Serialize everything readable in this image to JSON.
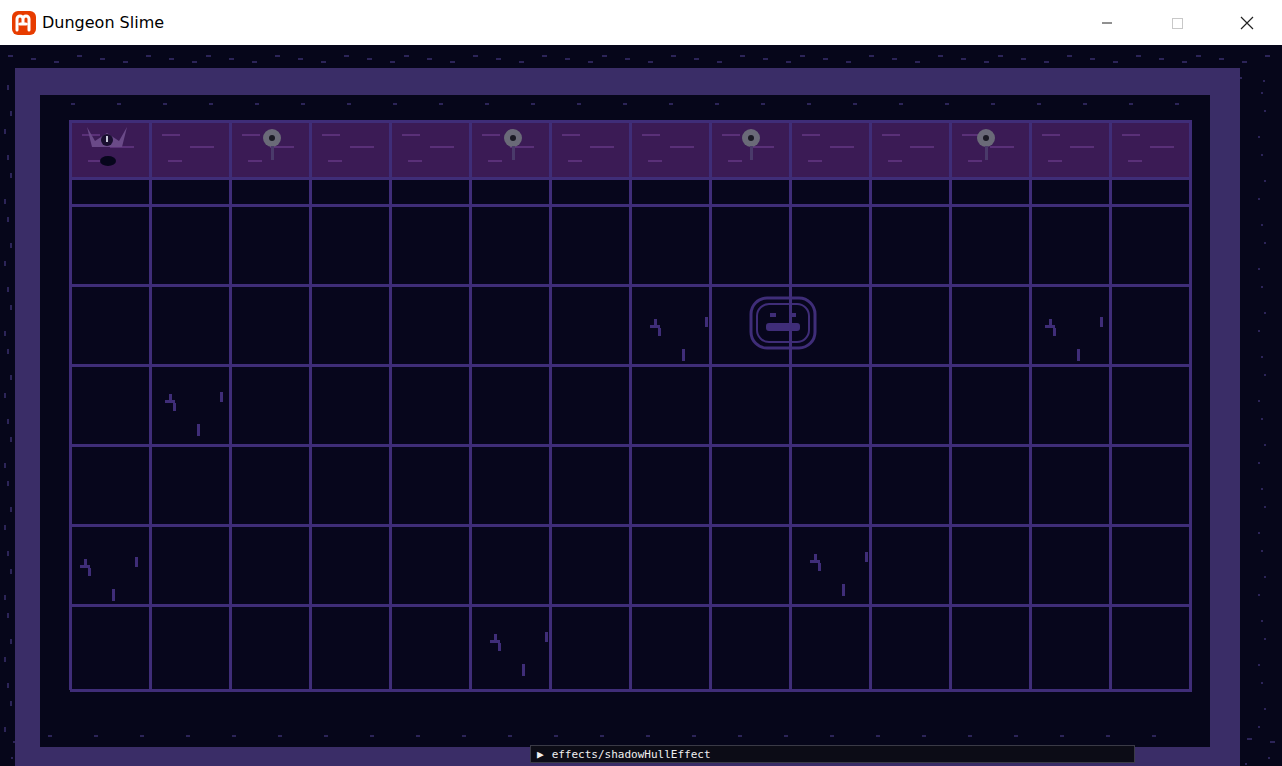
{
  "window": {
    "title": "Dungeon Slime",
    "controls": [
      {
        "kind": "minimize",
        "disabled": false
      },
      {
        "kind": "maximize",
        "disabled": true
      },
      {
        "kind": "close",
        "disabled": false
      }
    ]
  },
  "console": {
    "prompt": "▶",
    "command": "effects/shadowHullEffect"
  }
}
